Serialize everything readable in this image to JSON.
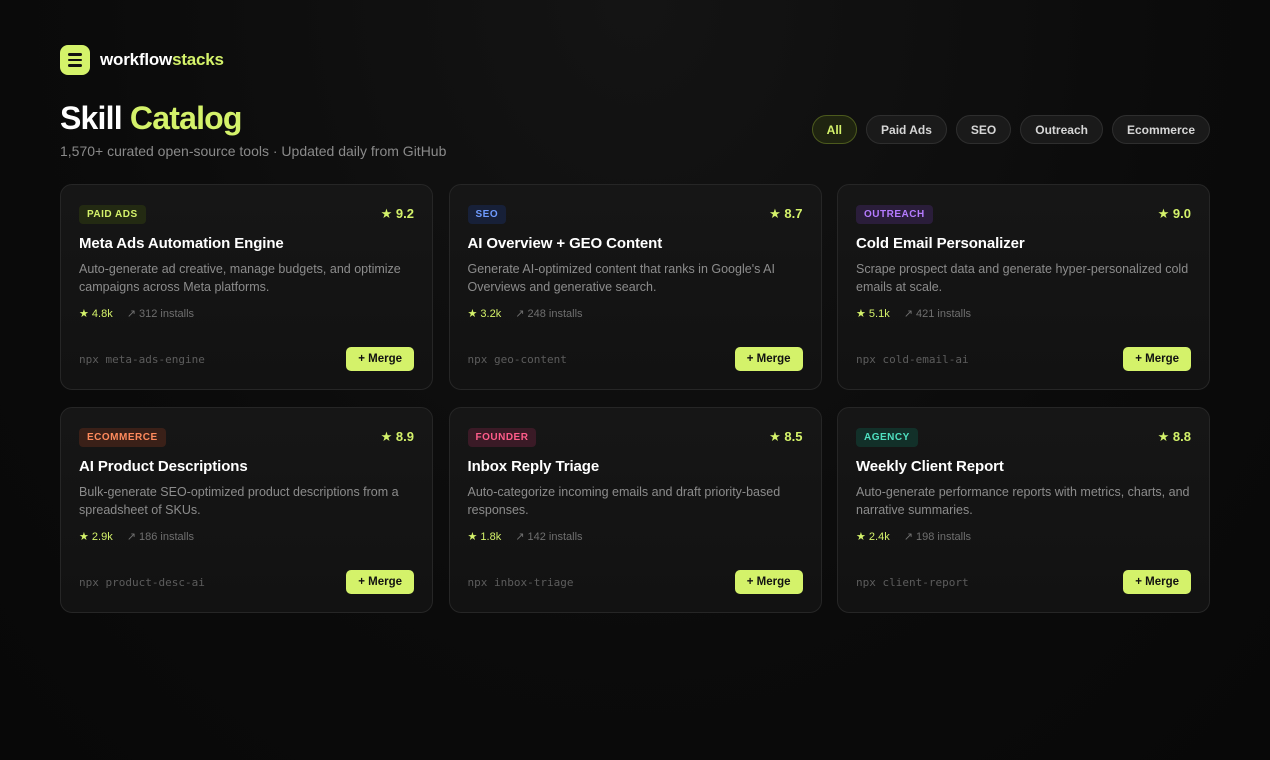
{
  "brand": {
    "name_part1": "workflow",
    "name_part2": "stacks"
  },
  "header": {
    "title_part1": "Skill",
    "title_part2": "Catalog",
    "subtitle": "1,570+ curated open-source tools · Updated daily from GitHub"
  },
  "filters": [
    {
      "label": "All",
      "active": true
    },
    {
      "label": "Paid Ads",
      "active": false
    },
    {
      "label": "SEO",
      "active": false
    },
    {
      "label": "Outreach",
      "active": false
    },
    {
      "label": "Ecommerce",
      "active": false
    }
  ],
  "cards": [
    {
      "tag": "PAID ADS",
      "tag_color": "#d4f26a",
      "tag_bg": "#232a12",
      "rating": "★ 9.2",
      "title": "Meta Ads Automation Engine",
      "description": "Auto-generate ad creative, manage budgets, and optimize campaigns across Meta platforms.",
      "stars": "★ 4.8k",
      "installs": "↗ 312 installs",
      "command": "npx meta-ads-engine",
      "button": "+ Merge"
    },
    {
      "tag": "SEO",
      "tag_color": "#6f9bff",
      "tag_bg": "#172038",
      "rating": "★ 8.7",
      "title": "AI Overview + GEO Content",
      "description": "Generate AI-optimized content that ranks in Google's AI Overviews and generative search.",
      "stars": "★ 3.2k",
      "installs": "↗ 248 installs",
      "command": "npx geo-content",
      "button": "+ Merge"
    },
    {
      "tag": "OUTREACH",
      "tag_color": "#b57bff",
      "tag_bg": "#2a1d3a",
      "rating": "★ 9.0",
      "title": "Cold Email Personalizer",
      "description": "Scrape prospect data and generate hyper-personalized cold emails at scale.",
      "stars": "★ 5.1k",
      "installs": "↗ 421 installs",
      "command": "npx cold-email-ai",
      "button": "+ Merge"
    },
    {
      "tag": "ECOMMERCE",
      "tag_color": "#ff8a5c",
      "tag_bg": "#3a2018",
      "rating": "★ 8.9",
      "title": "AI Product Descriptions",
      "description": "Bulk-generate SEO-optimized product descriptions from a spreadsheet of SKUs.",
      "stars": "★ 2.9k",
      "installs": "↗ 186 installs",
      "command": "npx product-desc-ai",
      "button": "+ Merge"
    },
    {
      "tag": "FOUNDER",
      "tag_color": "#ff5c8a",
      "tag_bg": "#3a1a26",
      "rating": "★ 8.5",
      "title": "Inbox Reply Triage",
      "description": "Auto-categorize incoming emails and draft priority-based responses.",
      "stars": "★ 1.8k",
      "installs": "↗ 142 installs",
      "command": "npx inbox-triage",
      "button": "+ Merge"
    },
    {
      "tag": "AGENCY",
      "tag_color": "#4fe0c0",
      "tag_bg": "#123029",
      "rating": "★ 8.8",
      "title": "Weekly Client Report",
      "description": "Auto-generate performance reports with metrics, charts, and narrative summaries.",
      "stars": "★ 2.4k",
      "installs": "↗ 198 installs",
      "command": "npx client-report",
      "button": "+ Merge"
    }
  ]
}
